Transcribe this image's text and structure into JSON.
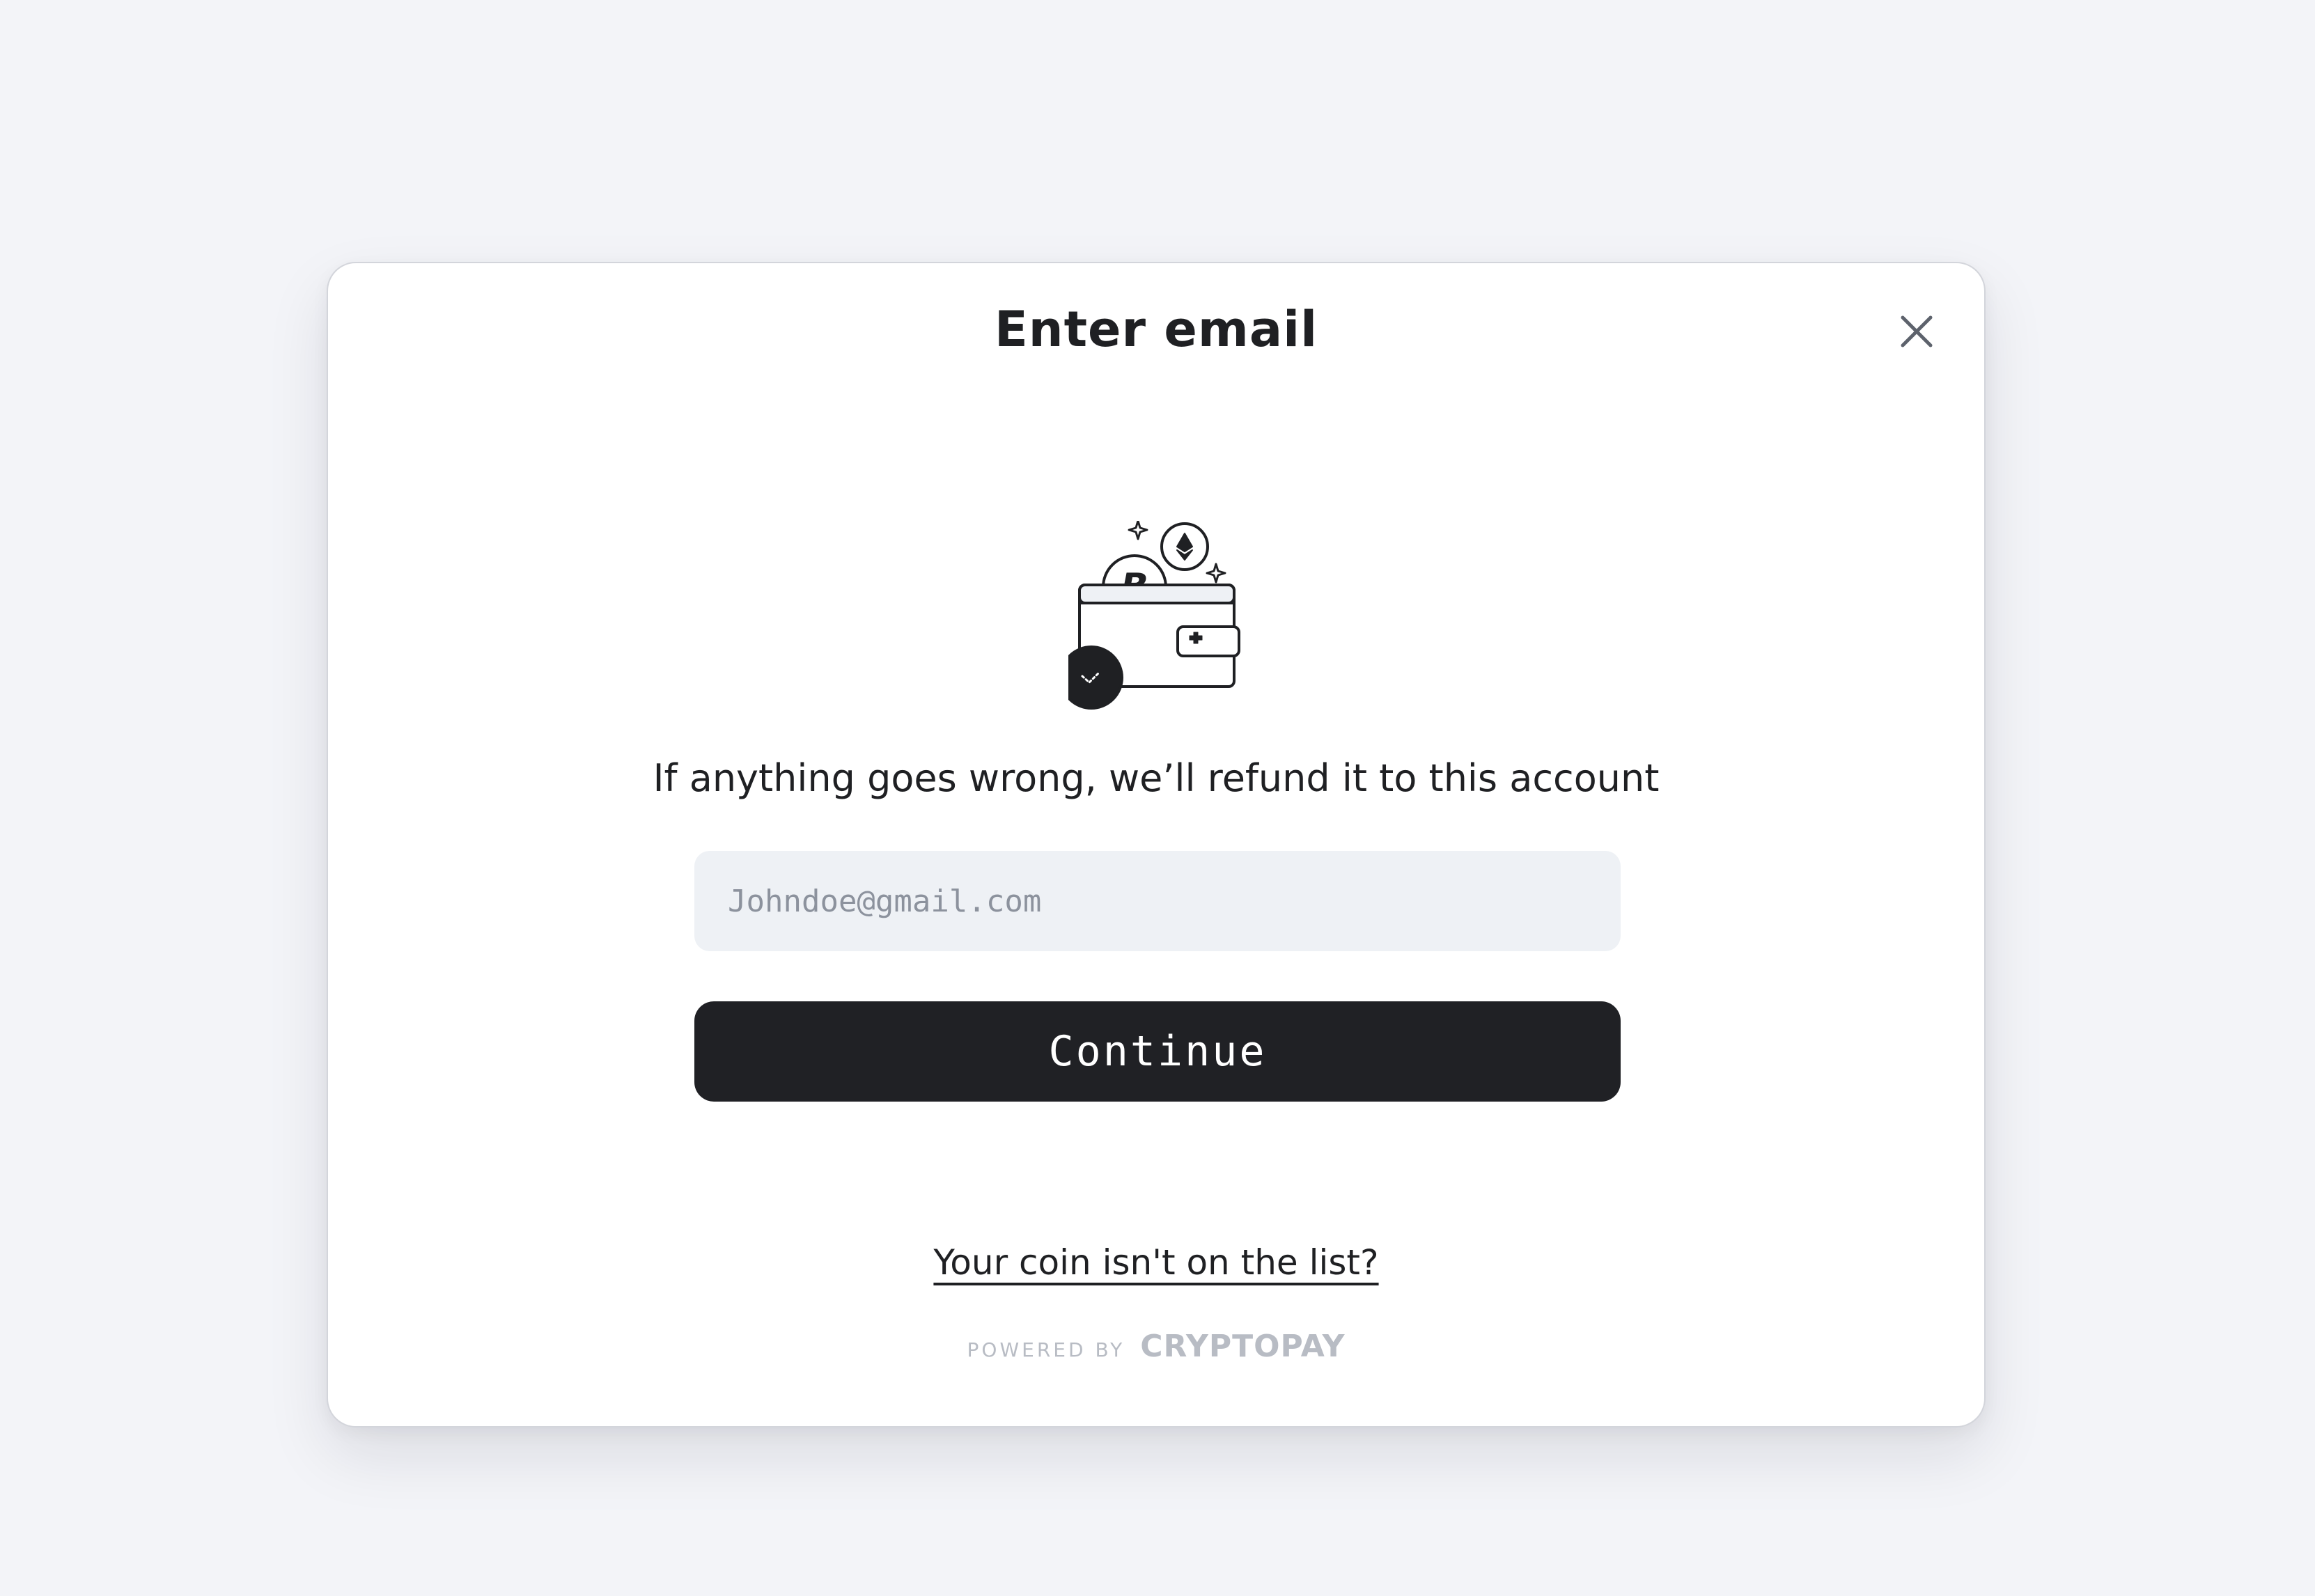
{
  "modal": {
    "title": "Enter email",
    "close_icon": "close-icon",
    "illustration_icon": "wallet-crypto-icon",
    "subtitle": "If anything goes wrong, we’ll refund it to this account",
    "email_field": {
      "value": "",
      "placeholder": "Johndoe@gmail.com"
    },
    "continue_label": "Continue",
    "coin_link_label": "Your coin isn't on the list?",
    "footer": {
      "powered_by": "POWERED BY",
      "brand": "CRYPTOPAY"
    }
  },
  "colors": {
    "background": "#f3f4f8",
    "modal": "#ffffff",
    "primary_button": "#202125",
    "input_background": "#eef1f5",
    "text": "#1f2023",
    "muted": "#b8bcc4"
  }
}
